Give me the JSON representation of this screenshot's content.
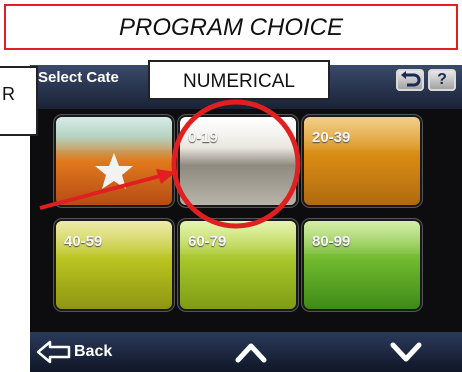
{
  "annotations": {
    "title": "PROGRAM CHOICE",
    "callout_label": "NUMERICAL",
    "left_box_text": "R",
    "highlight_color": "#e02020"
  },
  "screen": {
    "header": {
      "title": "Select Cate",
      "undo_button_icon": "undo-arrow-icon",
      "help_label": "?"
    },
    "tiles": [
      {
        "label": "",
        "icon": "star-icon",
        "color": "#e07a1c"
      },
      {
        "label": "0-19",
        "color": "#d7d4c8"
      },
      {
        "label": "20-39",
        "color": "#d88b13"
      },
      {
        "label": "40-59",
        "color": "#b8c320"
      },
      {
        "label": "60-79",
        "color": "#a7c52a"
      },
      {
        "label": "80-99",
        "color": "#6fb82d"
      }
    ],
    "footer": {
      "back_label": "Back",
      "up_icon": "chevron-up-icon",
      "down_icon": "chevron-down-icon"
    }
  }
}
